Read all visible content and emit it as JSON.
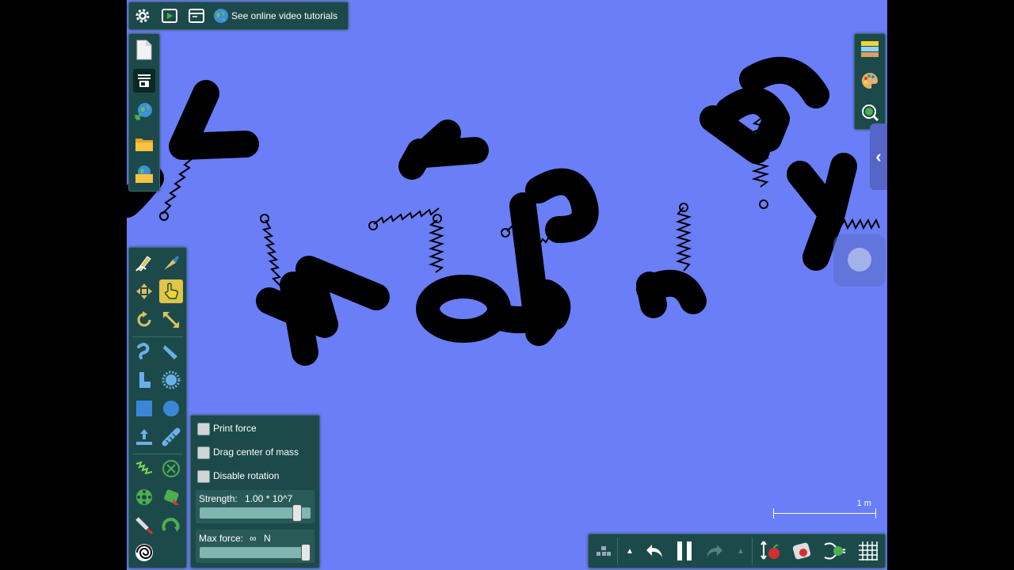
{
  "top_toolbar": {
    "tutorials_label": "See online video tutorials"
  },
  "options_panel": {
    "print_force_label": "Print force",
    "drag_com_label": "Drag center of mass",
    "disable_rotation_label": "Disable rotation",
    "strength_label": "Strength:",
    "strength_value": "1.00 * 10^7",
    "strength_fraction": 0.88,
    "max_force_label": "Max force:",
    "max_force_value": "∞",
    "max_force_unit": "N",
    "max_force_fraction": 1.0
  },
  "scale": {
    "label": "1 m"
  },
  "colors": {
    "background": "#6a7ef7",
    "panel": "#1c4a4a",
    "accent": "#4caf50"
  }
}
